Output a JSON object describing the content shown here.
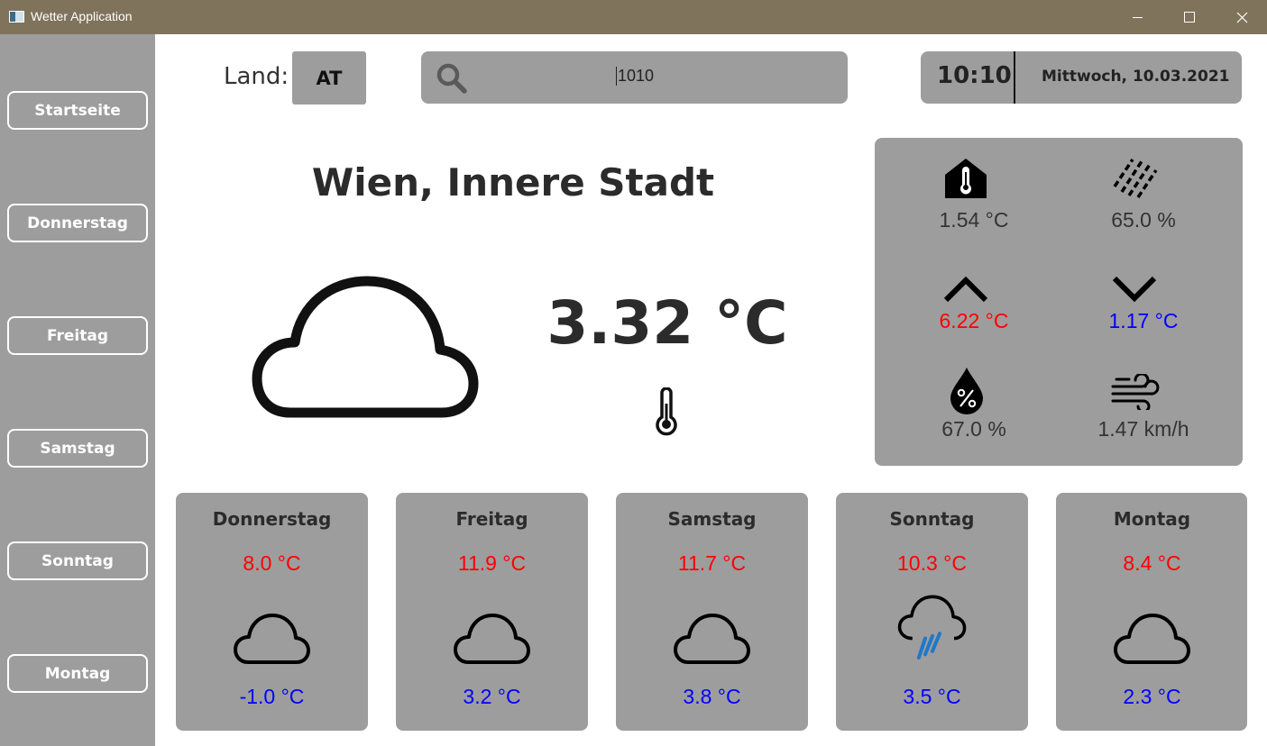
{
  "window": {
    "title": "Wetter Application"
  },
  "sidebar": {
    "items": [
      {
        "label": "Startseite"
      },
      {
        "label": "Donnerstag"
      },
      {
        "label": "Freitag"
      },
      {
        "label": "Samstag"
      },
      {
        "label": "Sonntag"
      },
      {
        "label": "Montag"
      }
    ]
  },
  "topbar": {
    "land_label": "Land:",
    "country": "AT",
    "search_value": "1010",
    "time": "10:10",
    "date": "Mittwoch, 10.03.2021"
  },
  "current": {
    "city": "Wien, Innere Stadt",
    "temperature": "3.32 °C",
    "icon": "cloud-icon"
  },
  "details": {
    "indoor_temp": "1.54 °C",
    "precipitation": "65.0 %",
    "max_temp": "6.22 °C",
    "min_temp": "1.17 °C",
    "humidity": "67.0 %",
    "wind": "1.47 km/h"
  },
  "forecast": [
    {
      "day": "Donnerstag",
      "max": "8.0 °C",
      "min": "-1.0 °C",
      "icon": "cloud-icon"
    },
    {
      "day": "Freitag",
      "max": "11.9 °C",
      "min": "3.2 °C",
      "icon": "cloud-icon"
    },
    {
      "day": "Samstag",
      "max": "11.7 °C",
      "min": "3.8 °C",
      "icon": "cloud-icon"
    },
    {
      "day": "Sonntag",
      "max": "10.3 °C",
      "min": "3.5 °C",
      "icon": "rain-cloud-icon"
    },
    {
      "day": "Montag",
      "max": "8.4 °C",
      "min": "2.3 °C",
      "icon": "cloud-icon"
    }
  ],
  "colors": {
    "max_temp": "#ff0000",
    "min_temp": "#0000ff",
    "rain": "#1f78c8",
    "panel": "#9d9d9d",
    "titlebar": "#7f735b"
  }
}
